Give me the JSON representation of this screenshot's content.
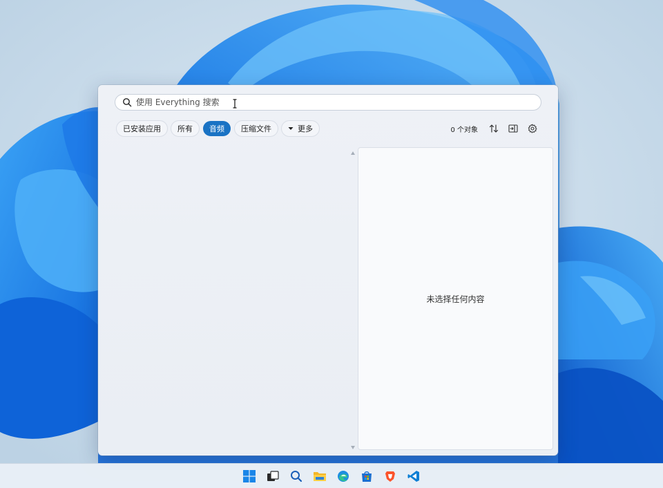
{
  "search": {
    "placeholder": "使用 Everything 搜索"
  },
  "filters": [
    {
      "label": "已安装应用",
      "active": false
    },
    {
      "label": "所有",
      "active": false
    },
    {
      "label": "音频",
      "active": true
    },
    {
      "label": "压缩文件",
      "active": false
    },
    {
      "label": "更多",
      "active": false,
      "dropdown": true
    }
  ],
  "status": {
    "object_count": "0 个对象"
  },
  "preview": {
    "empty_text": "未选择任何内容"
  },
  "colors": {
    "accent": "#1a73c4",
    "window_bg": "#eef1f6",
    "preview_bg": "#f9fafc"
  },
  "toolbar_icons": [
    "sort-icon",
    "panel-toggle-icon",
    "gear-icon"
  ],
  "taskbar": {
    "icons": [
      "windows-start-icon",
      "task-view-icon",
      "search-icon",
      "file-explorer-icon",
      "edge-icon",
      "microsoft-store-icon",
      "brave-icon",
      "vscode-icon"
    ]
  }
}
